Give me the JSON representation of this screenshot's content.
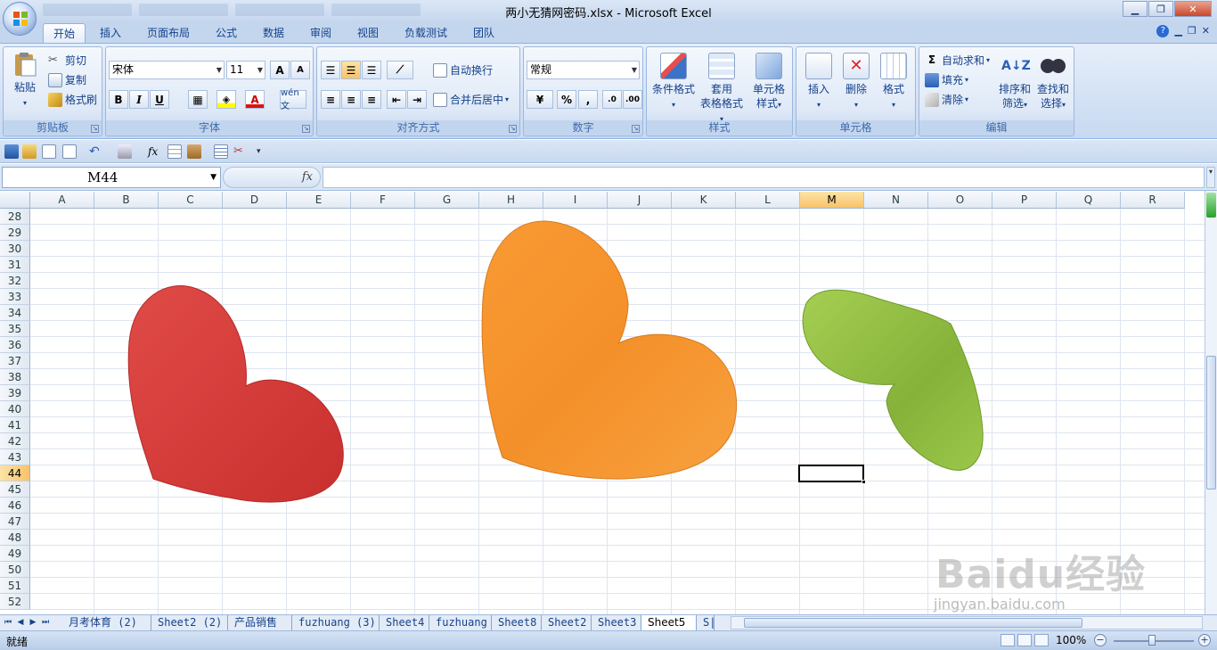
{
  "window": {
    "title": "两小无猜网密码.xlsx - Microsoft Excel"
  },
  "tabs": [
    "开始",
    "插入",
    "页面布局",
    "公式",
    "数据",
    "审阅",
    "视图",
    "负载测试",
    "团队"
  ],
  "ribbon": {
    "clipboard": {
      "paste": "粘贴",
      "cut": "剪切",
      "copy": "复制",
      "format_painter": "格式刷",
      "label": "剪贴板"
    },
    "font": {
      "name": "宋体",
      "size": "11",
      "label": "字体",
      "bold": "B",
      "italic": "I",
      "underline": "U",
      "grow": "A",
      "shrink": "A",
      "pinyin": "wén 文"
    },
    "alignment": {
      "wrap": "自动换行",
      "merge": "合并后居中",
      "label": "对齐方式"
    },
    "number": {
      "format": "常规",
      "percent": "%",
      "comma": ",",
      "label": "数字"
    },
    "styles": {
      "conditional": "条件格式",
      "table1": "套用",
      "table2": "表格格式",
      "cell1": "单元格",
      "cell2": "样式",
      "label": "样式"
    },
    "cells": {
      "insert": "插入",
      "delete": "删除",
      "format": "格式",
      "label": "单元格"
    },
    "editing": {
      "autosum": "自动求和",
      "fill": "填充",
      "clear": "清除",
      "sort1": "排序和",
      "sort2": "筛选",
      "find1": "查找和",
      "find2": "选择",
      "label": "编辑"
    }
  },
  "formula_bar": {
    "name_box": "M44",
    "fx": "fx",
    "value": ""
  },
  "columns": [
    "A",
    "B",
    "C",
    "D",
    "E",
    "F",
    "G",
    "H",
    "I",
    "J",
    "K",
    "L",
    "M",
    "N",
    "O",
    "P",
    "Q",
    "R"
  ],
  "rows": [
    "28",
    "29",
    "30",
    "31",
    "32",
    "33",
    "34",
    "35",
    "36",
    "37",
    "38",
    "39",
    "40",
    "41",
    "42",
    "43",
    "44",
    "45",
    "46",
    "47",
    "48",
    "49",
    "50",
    "51",
    "52"
  ],
  "selected": {
    "column": "M",
    "row": "44"
  },
  "shapes": [
    {
      "name": "red-heart",
      "color": "#d9403e"
    },
    {
      "name": "orange-heart",
      "color": "#f7952c"
    },
    {
      "name": "green-heart",
      "color": "#93c042"
    }
  ],
  "sheets": [
    "月考体育 (2)",
    "Sheet2 (2)",
    "产品销售",
    "fuzhuang (3)",
    "Sheet4",
    "fuzhuang",
    "Sheet8",
    "Sheet2",
    "Sheet3",
    "Sheet5",
    "S|"
  ],
  "active_sheet": "Sheet5",
  "status": {
    "text": "就绪",
    "zoom": "100%"
  },
  "watermark": {
    "logo": "Baidu经验",
    "url": "jingyan.baidu.com"
  }
}
